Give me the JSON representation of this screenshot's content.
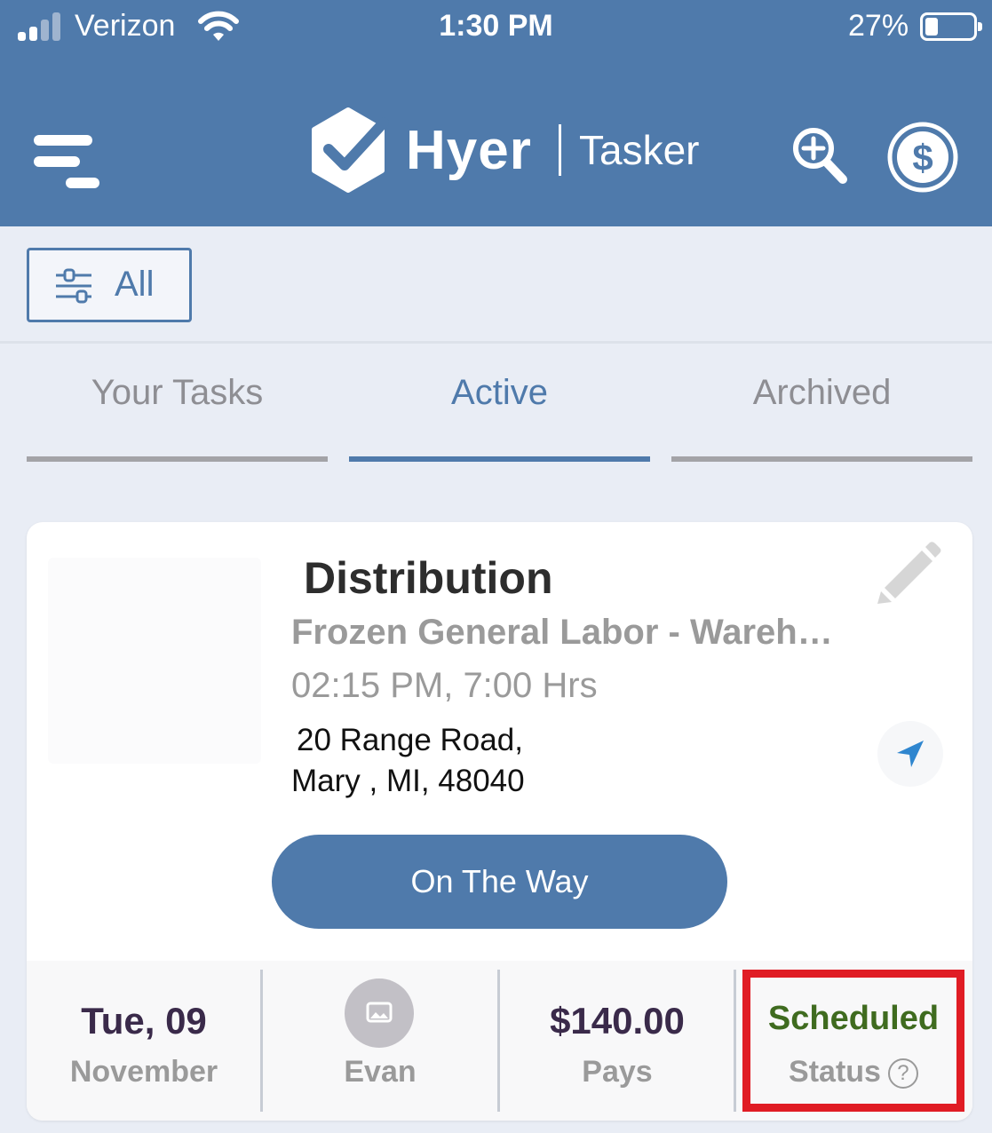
{
  "status_bar": {
    "carrier": "Verizon",
    "time": "1:30 PM",
    "battery_percent": "27%",
    "battery_level": 0.27
  },
  "header": {
    "brand": "Hyer",
    "brand_sub": "Tasker",
    "menu_icon": "hamburger-menu-icon",
    "search_icon": "zoom-search-icon",
    "money_icon": "dollar-circle-icon"
  },
  "filter": {
    "label": "All",
    "icon": "sliders-icon"
  },
  "tabs": [
    {
      "label": "Your Tasks",
      "active": false
    },
    {
      "label": "Active",
      "active": true
    },
    {
      "label": "Archived",
      "active": false
    }
  ],
  "task": {
    "title": "Distribution",
    "subtitle": "Frozen General Labor - Warehouse",
    "time": "02:15 PM, 7:00 Hrs",
    "address_line1": "20  Range Road,",
    "address_line2": "Mary , MI, 48040",
    "action_label": "On The Way",
    "edit_icon": "pencil-icon",
    "nav_icon": "navigation-arrow-icon"
  },
  "footer": {
    "date_value": "Tue, 09",
    "date_label": "November",
    "person_label": "Evan",
    "pay_value": "$140.00",
    "pay_label": "Pays",
    "status_value": "Scheduled",
    "status_label": "Status",
    "help_glyph": "?"
  },
  "colors": {
    "brand": "#4f7aab",
    "status": "#3f6b1f",
    "highlight": "#e01c24"
  }
}
